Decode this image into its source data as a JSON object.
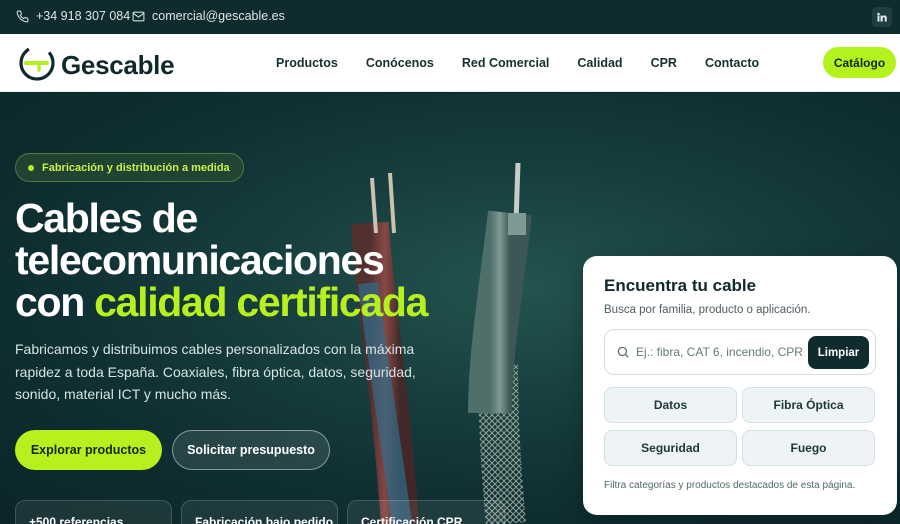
{
  "topbar": {
    "phone": "+34 918 307 084",
    "email": "comercial@gescable.es"
  },
  "header": {
    "logo_text": "Gescable",
    "nav": [
      "Productos",
      "Conócenos",
      "Red Comercial",
      "Calidad",
      "CPR",
      "Contacto"
    ],
    "catalog_label": "Catálogo"
  },
  "hero": {
    "badge": "Fabricación y distribución a medida",
    "title_line1": "Cables de",
    "title_line2": "telecomunicaciones",
    "title_line3_start": "con ",
    "title_line3_accent": "calidad certificada",
    "description": "Fabricamos y distribuimos cables personalizados con la máxima rapidez a toda España. Coaxiales, fibra óptica, datos, seguridad, sonido, material ICT y mucho más.",
    "primary_cta": "Explorar productos",
    "secondary_cta": "Solicitar presupuesto",
    "stats": [
      "+500 referencias",
      "Fabricación bajo pedido",
      "Certificación CPR"
    ]
  },
  "finder": {
    "title": "Encuentra tu cable",
    "subtitle": "Busca por familia, producto o aplicación.",
    "search_placeholder": "Ej.: fibra, CAT 6, incendio, CPR",
    "clear_label": "Limpiar",
    "chips": [
      "Datos",
      "Fibra Óptica",
      "Seguridad",
      "Fuego"
    ],
    "note": "Filtra categorías y productos destacados de esta página."
  },
  "colors": {
    "accent": "#b8f01f",
    "dark": "#0f2b2e"
  }
}
